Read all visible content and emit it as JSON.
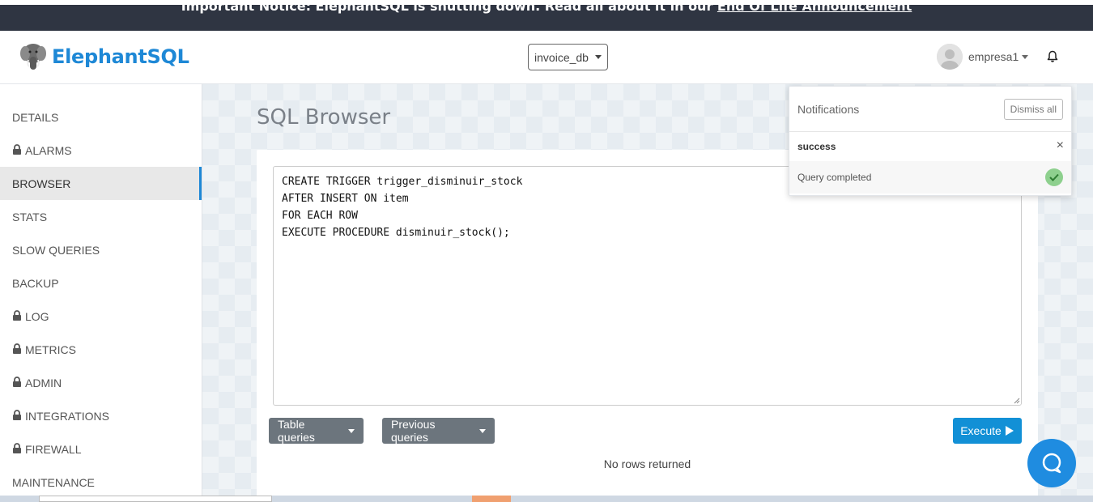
{
  "notice": {
    "text": "Important Notice: ElephantSQL is shutting down. Read all about it in our ",
    "link": "End Of Life Announcement"
  },
  "header": {
    "brand": "ElephantSQL",
    "database": "invoice_db",
    "username": "empresa1"
  },
  "sidebar": {
    "items": [
      {
        "label": "DETAILS",
        "locked": false,
        "active": false
      },
      {
        "label": "ALARMS",
        "locked": true,
        "active": false
      },
      {
        "label": "BROWSER",
        "locked": false,
        "active": true
      },
      {
        "label": "STATS",
        "locked": false,
        "active": false
      },
      {
        "label": "SLOW QUERIES",
        "locked": false,
        "active": false
      },
      {
        "label": "BACKUP",
        "locked": false,
        "active": false
      },
      {
        "label": "LOG",
        "locked": true,
        "active": false
      },
      {
        "label": "METRICS",
        "locked": true,
        "active": false
      },
      {
        "label": "ADMIN",
        "locked": true,
        "active": false
      },
      {
        "label": "INTEGRATIONS",
        "locked": true,
        "active": false
      },
      {
        "label": "FIREWALL",
        "locked": true,
        "active": false
      },
      {
        "label": "MAINTENANCE",
        "locked": false,
        "active": false
      }
    ]
  },
  "main": {
    "title": "SQL Browser",
    "query_lines": [
      "CREATE TRIGGER trigger_disminuir_stock",
      "AFTER INSERT ON item",
      "FOR EACH ROW",
      "EXECUTE PROCEDURE disminuir_stock();"
    ],
    "table_queries_label": "Table queries",
    "previous_queries_label": "Previous queries",
    "execute_label": "Execute",
    "result_text": "No rows returned"
  },
  "notifications": {
    "title": "Notifications",
    "dismiss_label": "Dismiss all",
    "close_glyph": "×",
    "type": "success",
    "message": "Query completed"
  },
  "colors": {
    "brand_blue": "#1e88d6",
    "execute_blue": "#1290d6",
    "banner": "#2f3542",
    "success_green": "#8ed08e"
  }
}
